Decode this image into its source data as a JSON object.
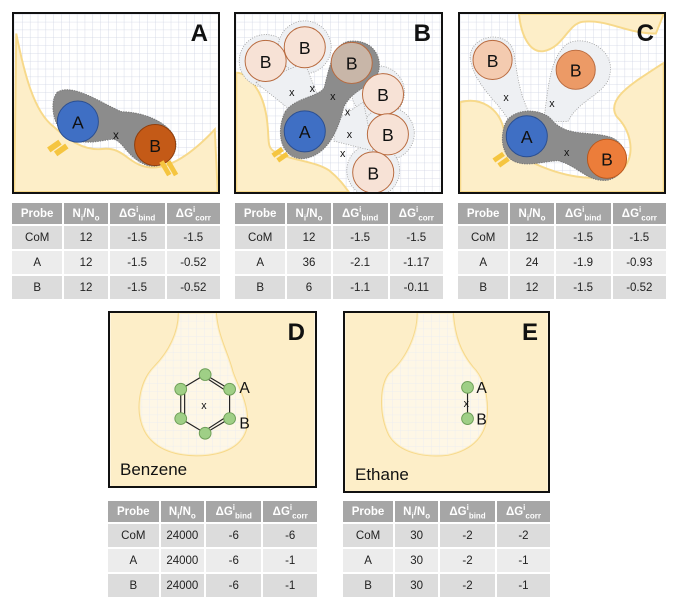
{
  "colors": {
    "pocket": "#fdeec8",
    "pocket_edge": "#f7d98a",
    "grid": "#c9cfe0",
    "probe_halo": "#8c8c8c",
    "atom_a": "#3f6fc4",
    "atom_b_dark": "#c45a17",
    "atom_b_orange": "#ec7d3a",
    "atom_b_light": "#f4cbb0",
    "atom_b_pale": "#f7e2d6",
    "atom_b_grey": "#c8b6a8",
    "green_atom": "#9fcf86",
    "anchor": "#f5c540",
    "header_bg": "#a6a6a6"
  },
  "panels": [
    {
      "id": "A",
      "letter": "A",
      "caption": "",
      "atoms": {
        "a": "A",
        "b": "B",
        "com": "x"
      }
    },
    {
      "id": "B",
      "letter": "B",
      "caption": "",
      "atoms": {
        "a": "A",
        "b": "B",
        "com": "x"
      }
    },
    {
      "id": "C",
      "letter": "C",
      "caption": "",
      "atoms": {
        "a": "A",
        "b": "B",
        "com": "x"
      }
    },
    {
      "id": "D",
      "letter": "D",
      "caption": "Benzene",
      "atoms": {
        "a": "A",
        "b": "B",
        "com": "x"
      }
    },
    {
      "id": "E",
      "letter": "E",
      "caption": "Ethane",
      "atoms": {
        "a": "A",
        "b": "B",
        "com": "x"
      }
    }
  ],
  "table_headers": {
    "probe": "Probe",
    "ratio_main": "N",
    "ratio_sub1": "i",
    "ratio_sep": "/N",
    "ratio_sub2": "o",
    "bind_main": "ΔG",
    "bind_sup": "i",
    "bind_sub": "bind",
    "corr_main": "ΔG",
    "corr_sup": "i",
    "corr_sub": "corr"
  },
  "tables": {
    "A": [
      {
        "probe": "CoM",
        "ratio": "12",
        "bind": "-1.5",
        "corr": "-1.5"
      },
      {
        "probe": "A",
        "ratio": "12",
        "bind": "-1.5",
        "corr": "-0.52"
      },
      {
        "probe": "B",
        "ratio": "12",
        "bind": "-1.5",
        "corr": "-0.52"
      }
    ],
    "B": [
      {
        "probe": "CoM",
        "ratio": "12",
        "bind": "-1.5",
        "corr": "-1.5"
      },
      {
        "probe": "A",
        "ratio": "36",
        "bind": "-2.1",
        "corr": "-1.17"
      },
      {
        "probe": "B",
        "ratio": "6",
        "bind": "-1.1",
        "corr": "-0.11"
      }
    ],
    "C": [
      {
        "probe": "CoM",
        "ratio": "12",
        "bind": "-1.5",
        "corr": "-1.5"
      },
      {
        "probe": "A",
        "ratio": "24",
        "bind": "-1.9",
        "corr": "-0.93"
      },
      {
        "probe": "B",
        "ratio": "12",
        "bind": "-1.5",
        "corr": "-0.52"
      }
    ],
    "D": [
      {
        "probe": "CoM",
        "ratio": "24000",
        "bind": "-6",
        "corr": "-6"
      },
      {
        "probe": "A",
        "ratio": "24000",
        "bind": "-6",
        "corr": "-1"
      },
      {
        "probe": "B",
        "ratio": "24000",
        "bind": "-6",
        "corr": "-1"
      }
    ],
    "E": [
      {
        "probe": "CoM",
        "ratio": "30",
        "bind": "-2",
        "corr": "-2"
      },
      {
        "probe": "A",
        "ratio": "30",
        "bind": "-2",
        "corr": "-1"
      },
      {
        "probe": "B",
        "ratio": "30",
        "bind": "-2",
        "corr": "-1"
      }
    ]
  }
}
